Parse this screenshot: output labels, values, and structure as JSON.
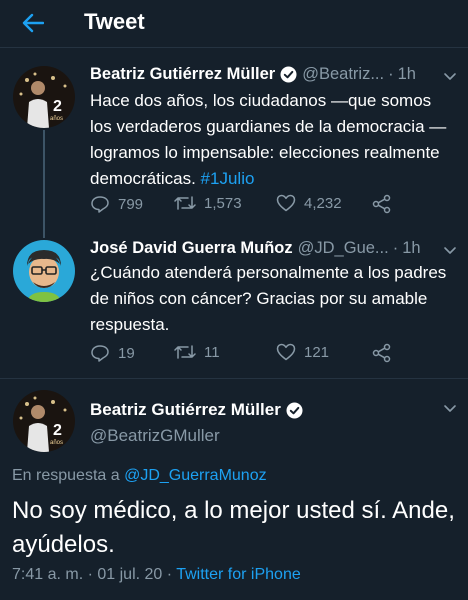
{
  "header": {
    "title": "Tweet"
  },
  "tweets": [
    {
      "name": "Beatriz Gutiérrez Müller",
      "handle": "@Beatriz...",
      "time": "1h",
      "text": "Hace dos años, los ciudadanos —que somos los verdaderos guardianes de la democracia —logramos lo impensable: elecciones realmente democráticas. ",
      "hashtag": "#1Julio",
      "replies": "799",
      "retweets": "1,573",
      "likes": "4,232",
      "verified": true
    },
    {
      "name": "José David Guerra Muñoz",
      "handle": "@JD_Gue...",
      "time": "1h",
      "text": "¿Cuándo atenderá personalmente a los padres de niños con cáncer? Gracias por su amable respuesta.",
      "replies": "19",
      "retweets": "11",
      "likes": "121",
      "verified": false
    }
  ],
  "focused": {
    "name": "Beatriz Gutiérrez Müller",
    "handle": "@BeatrizGMuller",
    "reply_prefix": "En respuesta a ",
    "reply_to": "@JD_GuerraMunoz",
    "text": "No soy médico, a lo mejor usted sí. Ande, ayúdelos.",
    "timestamp": "7:41 a. m. · 01 jul. 20 · ",
    "source": "Twitter for iPhone"
  },
  "colors": {
    "background": "#15202b",
    "accent": "#1da1f2",
    "muted": "#8899a6",
    "divider": "#253341"
  },
  "icons": [
    "back-arrow-icon",
    "verified-badge-icon",
    "chevron-down-icon",
    "reply-icon",
    "retweet-icon",
    "like-icon",
    "share-icon"
  ]
}
